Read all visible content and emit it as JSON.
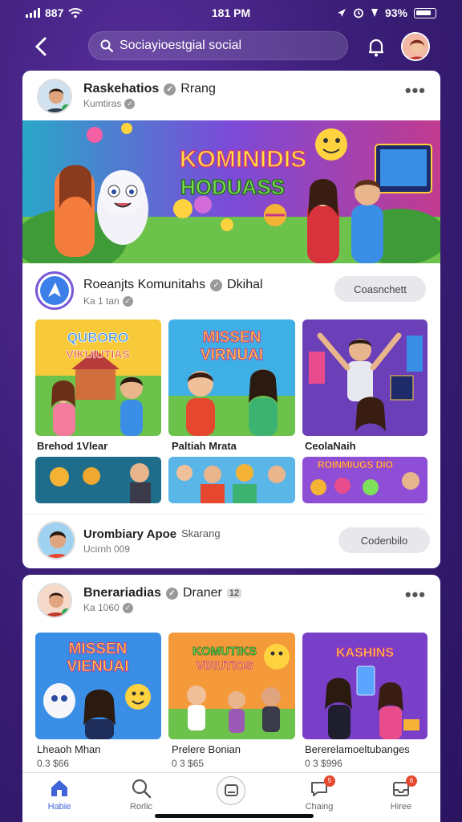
{
  "status_bar": {
    "signal": "887",
    "time": "181 PM",
    "battery": "93%"
  },
  "search": {
    "placeholder": "Sociayioestgial social"
  },
  "post1": {
    "name": "Raskehatios",
    "extra": "Rrang",
    "sub": "Kumtiras",
    "banner_title_line1": "KOMINIDIS",
    "banner_title_line2": "HODUASS"
  },
  "community": {
    "name": "Roeanjts Komunitahs",
    "extra": "Dkihal",
    "sub": "Ka 1 tan",
    "follow_label": "Coasnchett",
    "thumbs": [
      {
        "art_line1": "QUBORO",
        "art_line2": "VIKUIUTIAS",
        "title": "Brehod 1Vlear"
      },
      {
        "art_line1": "MISSEN",
        "art_line2": "VIRNUAI",
        "title": "Paltiah Mrata"
      },
      {
        "art_line1": "",
        "art_line2": "",
        "title": "CeolaNaih"
      }
    ],
    "strip_text": "ROINMIUGS DIO"
  },
  "suggestion": {
    "name": "Urombiary Apoe",
    "extra": "Skarang",
    "sub": "Ucirnh 009",
    "follow_label": "Codenbilo"
  },
  "post2": {
    "name": "Bnerariadias",
    "extra": "Draner",
    "badge": "12",
    "sub": "Ka 1060",
    "items": [
      {
        "art_line1": "MISSEN",
        "art_line2": "VIENUAI",
        "title": "Lheaoh Mhan",
        "sub": "0.3 $66"
      },
      {
        "art_line1": "KOMUTIKS",
        "art_line2": "VIRUTIOS",
        "title": "Prelere Bonian",
        "sub": "0 3 $65"
      },
      {
        "art_line1": "KASHINS",
        "art_line2": "",
        "title": "Bererelamoeltubanges",
        "sub": "0 3 $996"
      }
    ]
  },
  "bottom_nav": {
    "tabs": [
      {
        "label": "Habie"
      },
      {
        "label": "Rorlic"
      },
      {
        "label": ""
      },
      {
        "label": "Chaing"
      },
      {
        "label": "Hiree"
      }
    ],
    "badges": [
      "5",
      "6"
    ]
  },
  "colors": {
    "accent": "#3f64d8",
    "background": "#3d1f7a",
    "badge": "#e5482e"
  }
}
